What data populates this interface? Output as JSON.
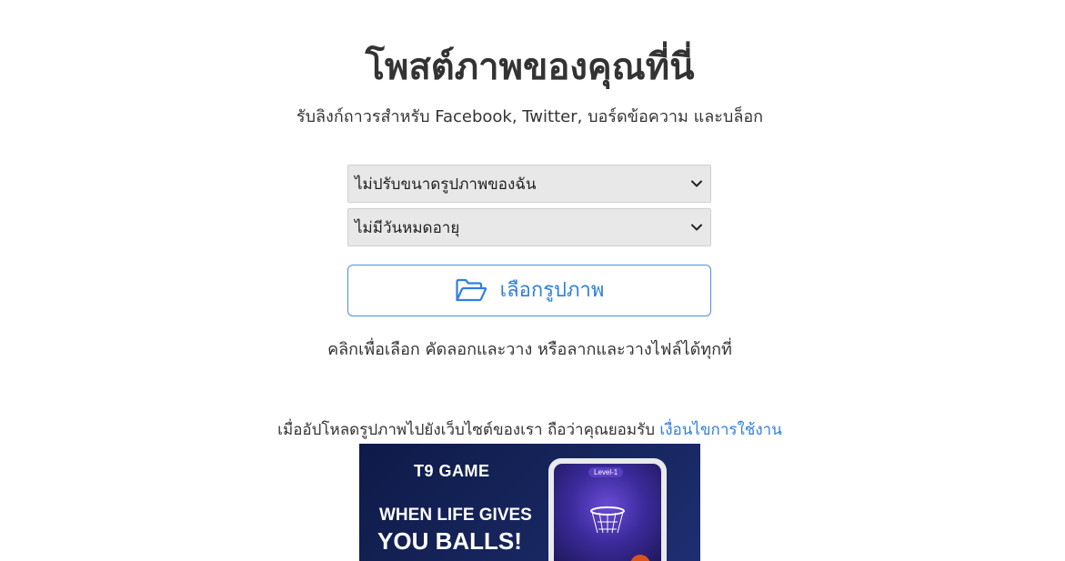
{
  "header": {
    "title": "โพสต์ภาพของคุณที่นี่",
    "subtitle": "รับลิงก์ถาวรสำหรับ Facebook, Twitter, บอร์ดข้อความ และบล็อก"
  },
  "upload_form": {
    "resize_select": {
      "selected": "ไม่ปรับขนาดรูปภาพของฉัน",
      "icon": "chevron-down-icon"
    },
    "expire_select": {
      "selected": "ไม่มีวันหมดอายุ",
      "icon": "chevron-down-icon"
    },
    "choose_button": {
      "label": "เลือกรูปภาพ",
      "icon": "folder-open-icon"
    },
    "hint": "คลิกเพื่อเลือก คัดลอกและวาง หรือลากและวางไฟล์ได้ทุกที่"
  },
  "terms": {
    "text": "เมื่ออัปโหลดรูปภาพไปยังเว็บไซต์ของเรา ถือว่าคุณยอมรับ",
    "link_label": "เงื่อนไขการใช้งาน"
  },
  "ad": {
    "brand": "T9 GAME",
    "line1": "WHEN LIFE GIVES",
    "line2": "YOU BALLS!",
    "level_label": "Level-1"
  },
  "colors": {
    "accent": "#2f7fdf",
    "text": "#333333",
    "select_bg": "#e8e8e8",
    "ad_bg": "#17265e"
  }
}
